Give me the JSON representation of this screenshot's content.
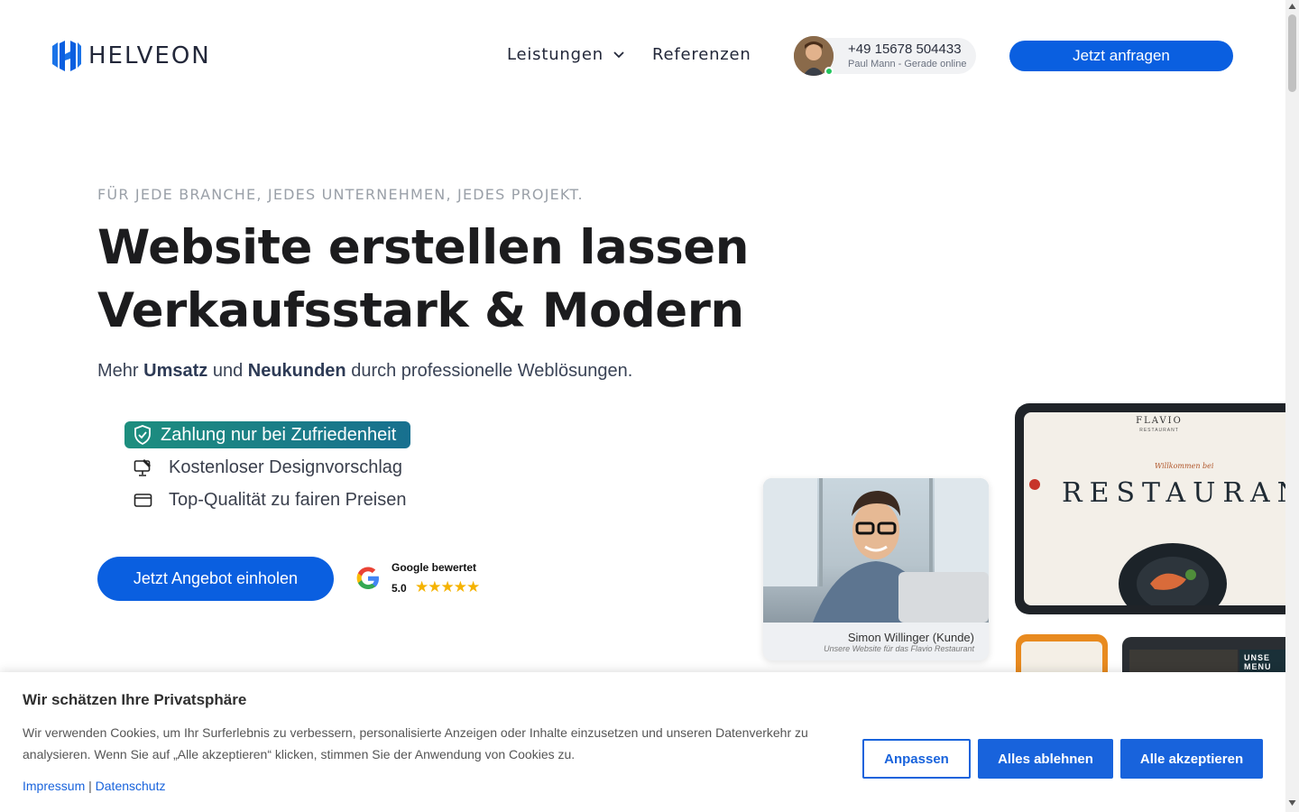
{
  "header": {
    "logo_text": "HELVEON",
    "nav": [
      {
        "label": "Leistungen",
        "has_dropdown": true
      },
      {
        "label": "Referenzen",
        "has_dropdown": false
      }
    ],
    "contact": {
      "phone": "+49 15678 504433",
      "status": "Paul Mann - Gerade online"
    },
    "cta_label": "Jetzt anfragen"
  },
  "hero": {
    "eyebrow": "FÜR JEDE BRANCHE, JEDES UNTERNEHMEN, JEDES PROJEKT.",
    "title_line1": "Website erstellen lassen",
    "title_line2": "Verkaufsstark & Modern",
    "lead": {
      "pre": "Mehr ",
      "b1": "Umsatz",
      "mid": " und ",
      "b2": "Neukunden",
      "post": " durch professionelle Weblösungen."
    },
    "features": [
      {
        "icon": "shield-check-icon",
        "label": "Zahlung nur bei Zufriedenheit",
        "highlighted": true
      },
      {
        "icon": "monitor-edit-icon",
        "label": "Kostenloser Designvorschlag"
      },
      {
        "icon": "wallet-icon",
        "label": "Top-Qualität zu fairen Preisen"
      }
    ],
    "cta_label": "Jetzt Angebot einholen",
    "google": {
      "title": "Google bewertet",
      "score": "5.0",
      "stars": "★★★★★"
    }
  },
  "testimonial": {
    "name": "Simon Willinger (Kunde)",
    "caption": "Unsere Website für das Flavio Restaurant"
  },
  "mockup": {
    "brand": "FLAVIO",
    "brand_sub": "RESTAURANT",
    "welcome": "Willkommen bei",
    "headline": "RESTAURANT",
    "side_text": "UNSE MENU"
  },
  "cookie": {
    "title": "Wir schätzen Ihre Privatsphäre",
    "text": "Wir verwenden Cookies, um Ihr Surferlebnis zu verbessern, personalisierte Anzeigen oder Inhalte einzusetzen und unseren Datenverkehr zu analysieren. Wenn Sie auf „Alle akzeptieren“ klicken, stimmen Sie der Anwendung von Cookies zu.",
    "link_impressum": "Impressum",
    "separator": "|",
    "link_datenschutz": "Datenschutz",
    "btn_customize": "Anpassen",
    "btn_reject": "Alles ablehnen",
    "btn_accept": "Alle akzeptieren"
  },
  "colors": {
    "primary": "#0a5fe0",
    "badge_from": "#1d8e7e",
    "badge_to": "#18708f",
    "online": "#22c55e",
    "star": "#f5b301"
  }
}
